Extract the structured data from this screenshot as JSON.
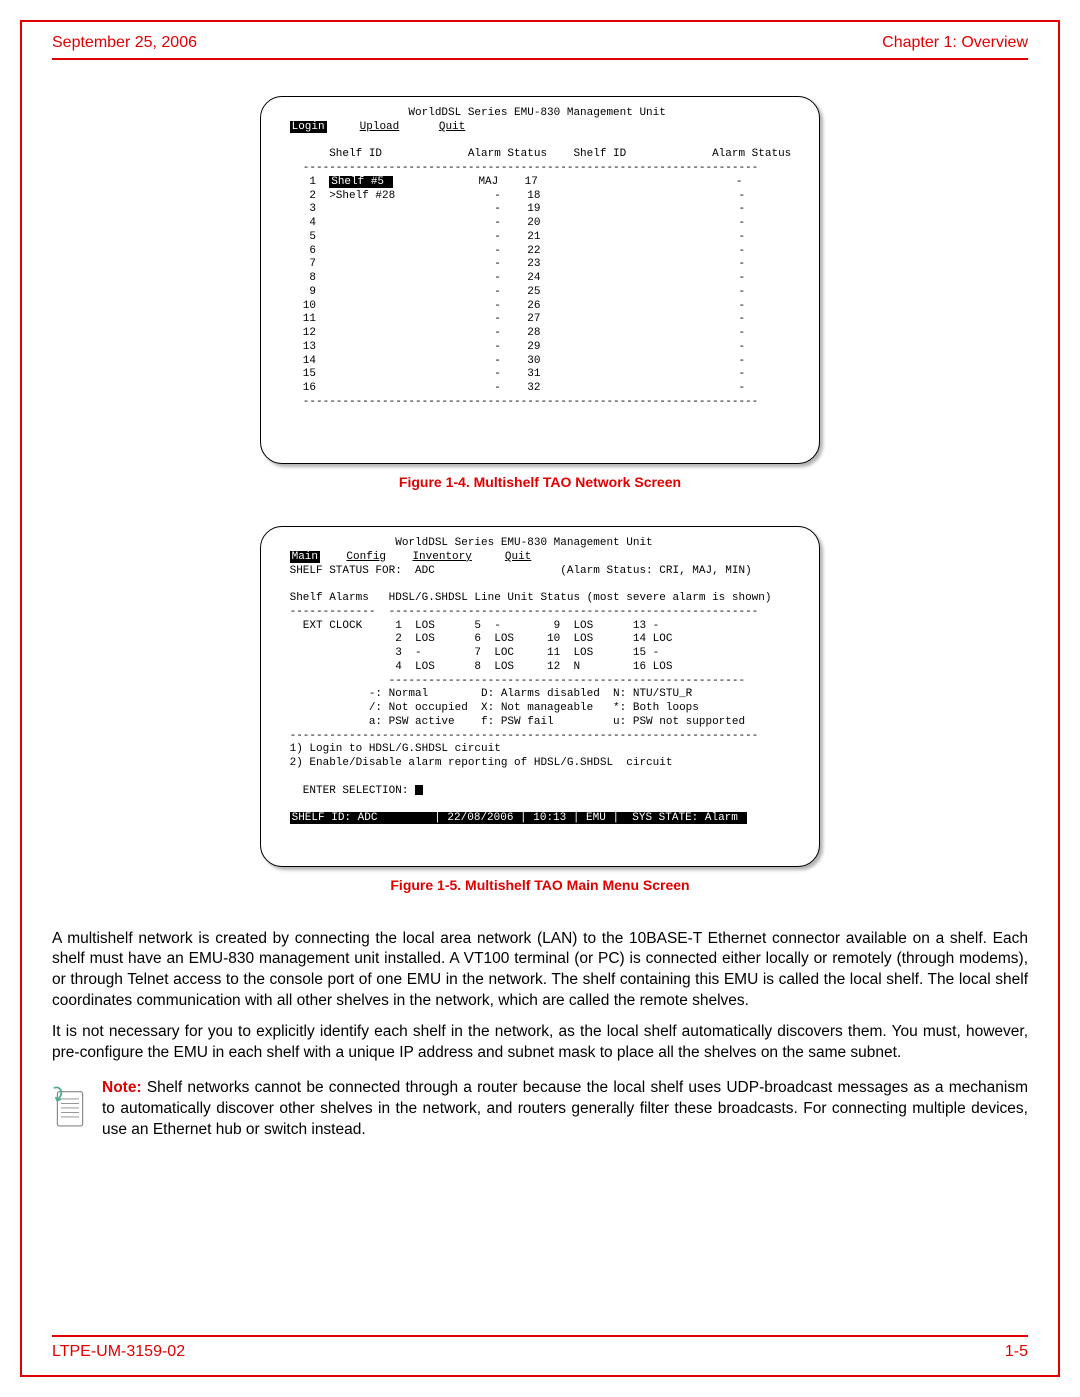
{
  "header": {
    "date": "September 25, 2006",
    "chapter": "Chapter 1: Overview"
  },
  "fig1": {
    "caption": "Figure 1-4. Multishelf TAO Network Screen",
    "title_line": "                   WorldDSL Series EMU-830 Management Unit",
    "menu": {
      "login": "Login",
      "upload": "Upload",
      "quit": "Quit"
    },
    "col_headers": "       Shelf ID             Alarm Status    Shelf ID             Alarm Status",
    "row01_a": "    1  ",
    "row01_shelf": "Shelf #5 ",
    "row01_b": "             MAJ    17                              -",
    "row02": "    2  >Shelf #28               -    18                              -",
    "rows_rest": "    3                           -    19                              -\n    4                           -    20                              -\n    5                           -    21                              -\n    6                           -    22                              -\n    7                           -    23                              -\n    8                           -    24                              -\n    9                           -    25                              -\n   10                           -    26                              -\n   11                           -    27                              -\n   12                           -    28                              -\n   13                           -    29                              -\n   14                           -    30                              -\n   15                           -    31                              -\n   16                           -    32                              -"
  },
  "fig2": {
    "caption": "Figure 1-5. Multishelf TAO Main Menu Screen",
    "title_line": "                 WorldDSL Series EMU-830 Management Unit",
    "menu": {
      "main": "Main",
      "config": "Config",
      "inventory": "Inventory",
      "quit": "Quit"
    },
    "status_for": " SHELF STATUS FOR:  ADC                   (Alarm Status: CRI, MAJ, MIN)",
    "shelf_alarms_hdr": " Shelf Alarms   HDSL/G.SHDSL Line Unit Status (most severe alarm is shown)",
    "grid": "   EXT CLOCK     1  LOS      5  -        9  LOS      13 -\n                 2  LOS      6  LOS     10  LOS      14 LOC\n                 3  -        7  LOC     11  LOS      15 -\n                 4  LOS      8  LOS     12  N        16 LOS",
    "legend": "             -: Normal        D: Alarms disabled  N: NTU/STU_R\n             /: Not occupied  X: Not manageable   *: Both loops\n             a: PSW active    f: PSW fail         u: PSW not supported",
    "opts": " 1) Login to HDSL/G.SHDSL circuit\n 2) Enable/Disable alarm reporting of HDSL/G.SHDSL  circuit",
    "enter_sel": "   ENTER SELECTION: ",
    "status_bar_a": "SHELF ID: ADC        ",
    "status_bar_b": "| 22/08/2006 | 10:13 | EMU |  SYS STATE: Alarm "
  },
  "para1": "A multishelf network is created by connecting the local area network (LAN) to the 10BASE-T Ethernet connector available on a shelf. Each shelf must have an EMU-830 management unit installed. A VT100 terminal (or PC) is connected either locally or remotely (through modems), or through Telnet access to the console port of one EMU in the network. The shelf containing this EMU is called the local shelf. The local shelf coordinates communication with all other shelves in the network, which are called the remote shelves.",
  "para2": "It is not necessary for you to explicitly identify each shelf in the network, as the local shelf automatically discovers them. You must, however, pre-configure the EMU in each shelf with a unique IP address and subnet mask to place all the shelves on the same subnet.",
  "note": {
    "label": "Note:",
    "text": " Shelf networks cannot be connected through a router because the local shelf uses UDP-broadcast messages as a mechanism to automatically discover other shelves in the network, and routers generally filter these broadcasts. For connecting multiple devices, use an Ethernet hub or switch instead."
  },
  "footer": {
    "doc_id": "LTPE-UM-3159-02",
    "page_no": "1-5"
  }
}
